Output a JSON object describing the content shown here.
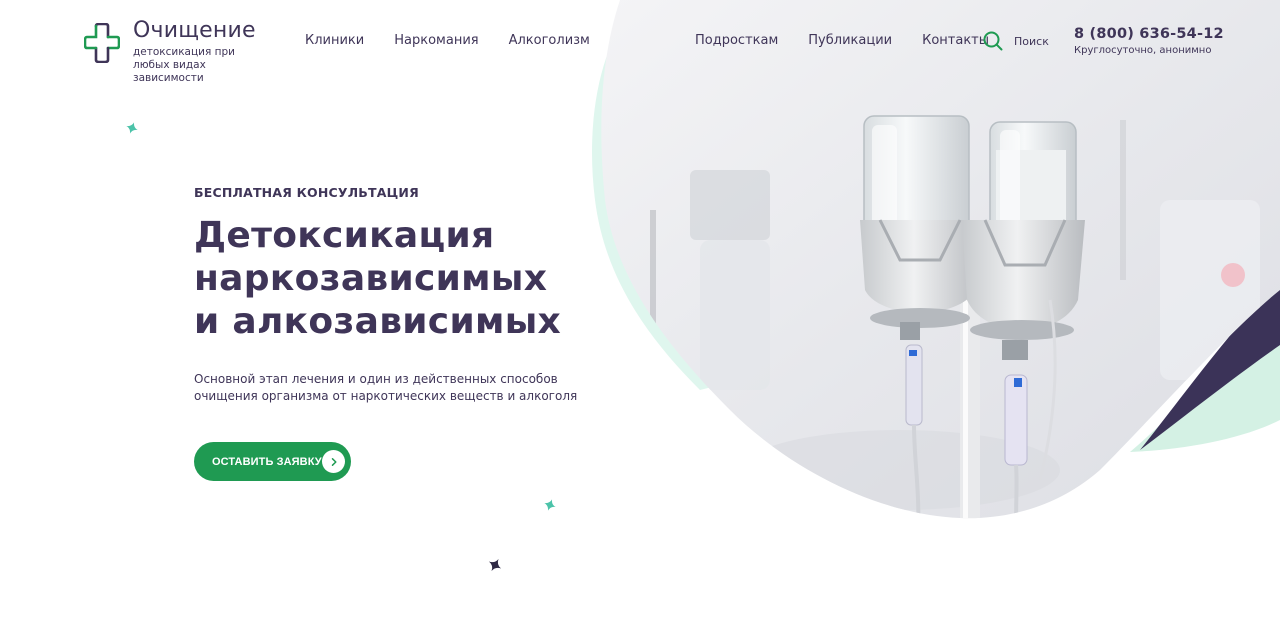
{
  "header": {
    "logo": {
      "name": "Очищение",
      "tagline": "детоксикация при любых видах зависимости"
    },
    "nav_left": [
      {
        "label": "Клиники"
      },
      {
        "label": "Наркомания"
      },
      {
        "label": "Алкоголизм"
      }
    ],
    "nav_right": [
      {
        "label": "Подросткам"
      },
      {
        "label": "Публикации"
      },
      {
        "label": "Контакты"
      }
    ],
    "search": {
      "label": "Поиск",
      "icon": "search-icon"
    },
    "phone": {
      "number": "8 (800) 636-54-12",
      "note": "Круглосуточно, анонимно"
    }
  },
  "hero": {
    "eyebrow": "БЕСПЛАТНАЯ КОНСУЛЬТАЦИЯ",
    "headline": [
      "Детоксикация",
      "наркозависимых",
      "и алкозависимых"
    ],
    "lead": [
      "Основной этап лечения и один из действенных способов",
      "очищения организма от наркотических веществ и алкоголя"
    ],
    "cta": {
      "label": "ОСТАВИТЬ ЗАЯВКУ",
      "icon": "chevron-right-icon"
    },
    "image": {
      "subject": "iv-drip-bottles-photo"
    }
  },
  "colors": {
    "primary_text": "#3f3558",
    "accent_green": "#1f9a52",
    "mint": "#d9f5ea",
    "dark_purple": "#3b3358",
    "teal_sparkle": "#4cc3a9"
  }
}
